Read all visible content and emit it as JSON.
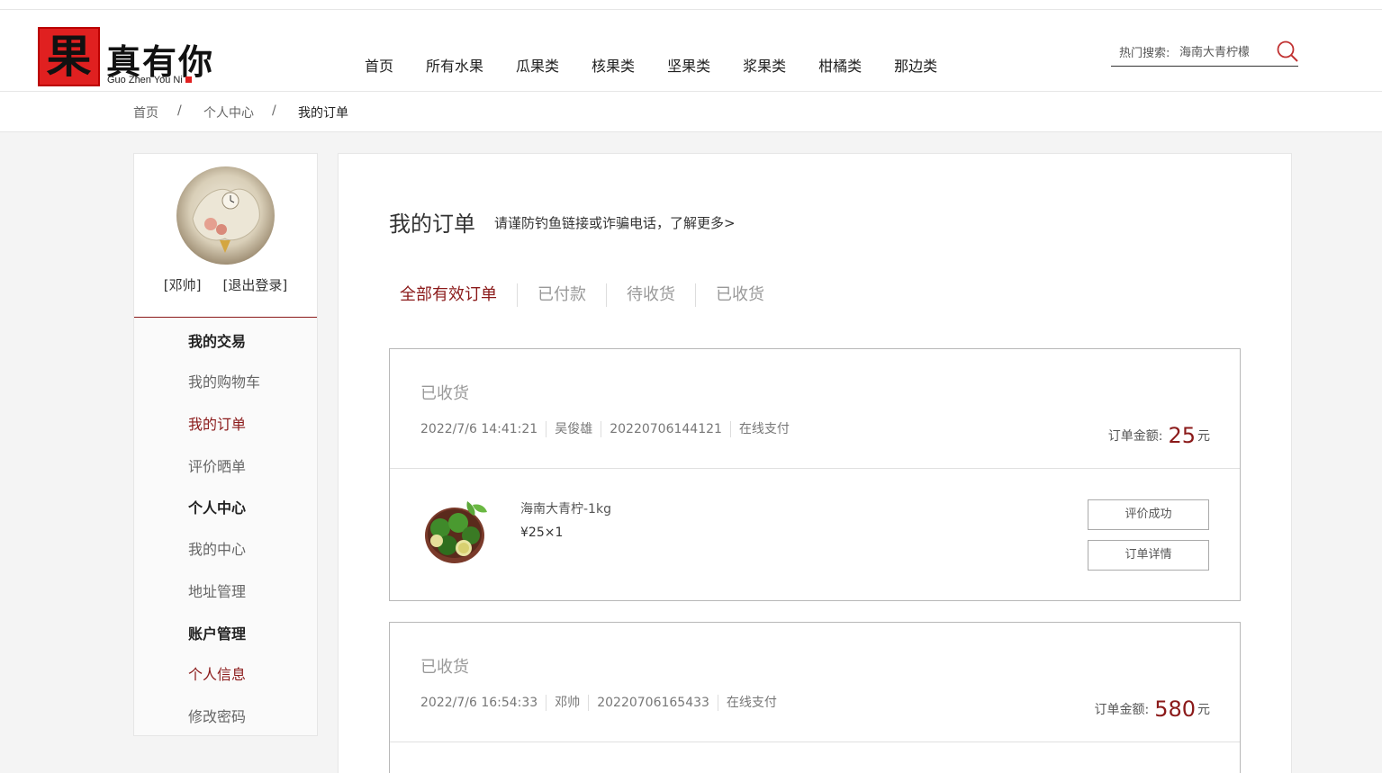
{
  "header": {
    "logo_char": "果",
    "logo_text": "真有你",
    "logo_sub": "Guo Zhen You Ni",
    "nav": [
      "首页",
      "所有水果",
      "瓜果类",
      "核果类",
      "坚果类",
      "浆果类",
      "柑橘类",
      "那边类"
    ],
    "search_label": "热门搜索:",
    "search_value": "海南大青柠檬"
  },
  "breadcrumb": {
    "home": "首页",
    "sep": "/",
    "center": "个人中心",
    "current": "我的订单"
  },
  "sidebar": {
    "user_name": "[邓帅]",
    "logout": "[退出登录]",
    "group_trade": "我的交易",
    "cart": "我的购物车",
    "orders": "我的订单",
    "review": "评价晒单",
    "group_center": "个人中心",
    "my_center": "我的中心",
    "address": "地址管理",
    "group_account": "账户管理",
    "profile": "个人信息",
    "password": "修改密码"
  },
  "main": {
    "title": "我的订单",
    "tip": "请谨防钓鱼链接或诈骗电话，了解更多>",
    "tabs": [
      "全部有效订单",
      "已付款",
      "待收货",
      "已收货"
    ],
    "active_tab": "全部有效订单"
  },
  "orders": [
    {
      "status": "已收货",
      "time": "2022/7/6 14:41:21",
      "buyer": "吴俊雄",
      "order_no": "20220706144121",
      "pay": "在线支付",
      "amount_label": "订单金额:",
      "amount": "25",
      "unit": "元",
      "product_name": "海南大青柠-1kg",
      "product_price": "¥25×1",
      "btn_review": "评价成功",
      "btn_detail": "订单详情"
    },
    {
      "status": "已收货",
      "time": "2022/7/6 16:54:33",
      "buyer": "邓帅",
      "order_no": "20220706165433",
      "pay": "在线支付",
      "amount_label": "订单金额:",
      "amount": "580",
      "unit": "元"
    }
  ],
  "colors": {
    "accent": "#8b1a1a",
    "logo_red": "#e02020"
  }
}
